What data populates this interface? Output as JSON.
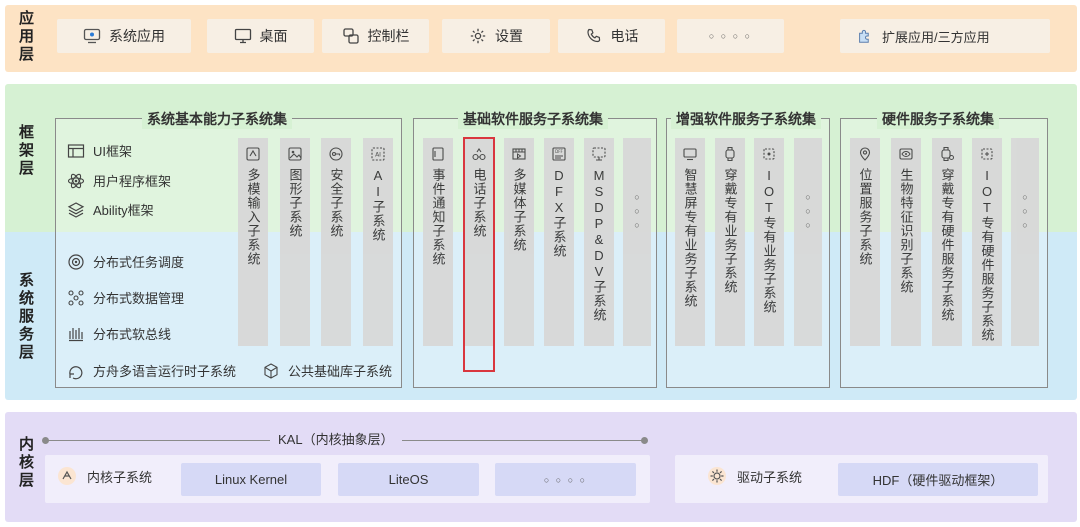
{
  "layers": {
    "app": "应用层",
    "framework": "框架层",
    "system_service": "系统服务层",
    "kernel": "内核层"
  },
  "app_layer": {
    "system_app": "系统应用",
    "desktop": "桌面",
    "control_bar": "控制栏",
    "settings": "设置",
    "phone": "电话",
    "more": "○ ○ ○ ○",
    "ext_app": "扩展应用/三方应用"
  },
  "basic_capability": {
    "title": "系统基本能力子系统集",
    "ui_framework": "UI框架",
    "user_program_framework": "用户程序框架",
    "ability_framework": "Ability框架",
    "dist_task": "分布式任务调度",
    "dist_data": "分布式数据管理",
    "dist_bus": "分布式软总线",
    "ark_runtime": "方舟多语言运行时子系统",
    "common_lib": "公共基础库子系统",
    "columns": [
      "多模输入子系统",
      "图形子系统",
      "安全子系统",
      "AI子系统"
    ]
  },
  "basic_software": {
    "title": "基础软件服务子系统集",
    "columns": [
      "事件通知子系统",
      "电话子系统",
      "多媒体子系统",
      "DFX子系统",
      "MSDP&DV子系统"
    ],
    "more": "○○○"
  },
  "enhanced_software": {
    "title": "增强软件服务子系统集",
    "columns": [
      "智慧屏专有业务子系统",
      "穿戴专有业务子系统",
      "IOT专有业务子系统"
    ],
    "more": "○○○"
  },
  "hardware_service": {
    "title": "硬件服务子系统集",
    "columns": [
      "位置服务子系统",
      "生物特征识别子系统",
      "穿戴专有硬件服务子系统",
      "IOT专有硬件服务子系统"
    ],
    "more": "○○○"
  },
  "kernel_layer": {
    "kal": "KAL（内核抽象层）",
    "kernel_subsystem": "内核子系统",
    "linux_kernel": "Linux Kernel",
    "liteos": "LiteOS",
    "more": "○ ○ ○ ○",
    "driver_subsystem": "驱动子系统",
    "hdf": "HDF（硬件驱动框架）"
  },
  "colors": {
    "app_band": "#fde3c4",
    "framework_band": "#d6f1d3",
    "service_band": "#cfeaf7",
    "kernel_band": "#e3dcf6",
    "highlight": "#d9363e"
  }
}
